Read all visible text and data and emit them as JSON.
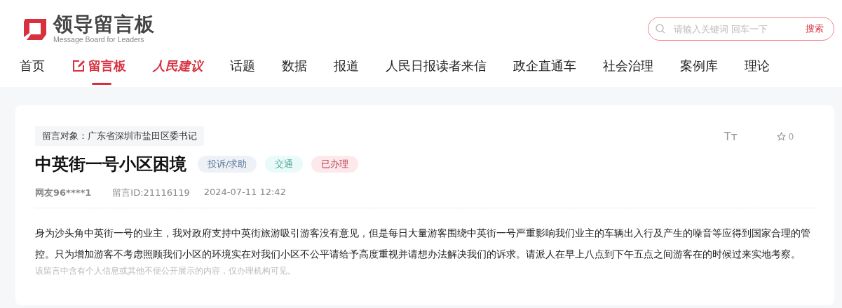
{
  "logo": {
    "title": "领导留言板",
    "subtitle": "Message Board for Leaders"
  },
  "search": {
    "placeholder": "请输入关键词 回车一下",
    "button": "搜索"
  },
  "nav": [
    {
      "label": "首页",
      "kind": "text",
      "selected": false
    },
    {
      "label": "留言板",
      "kind": "icon",
      "selected": true
    },
    {
      "label": "人民建议",
      "kind": "brand",
      "selected": false
    },
    {
      "label": "话题",
      "kind": "text",
      "selected": false
    },
    {
      "label": "数据",
      "kind": "text",
      "selected": false
    },
    {
      "label": "报道",
      "kind": "text",
      "selected": false
    },
    {
      "label": "人民日报读者来信",
      "kind": "text",
      "selected": false
    },
    {
      "label": "政企直通车",
      "kind": "text",
      "selected": false
    },
    {
      "label": "社会治理",
      "kind": "text",
      "selected": false
    },
    {
      "label": "案例库",
      "kind": "text",
      "selected": false
    },
    {
      "label": "理论",
      "kind": "text",
      "selected": false
    }
  ],
  "message": {
    "target": "留言对象：广东省深圳市盐田区委书记",
    "title": "中英街一号小区困境",
    "tags": [
      {
        "label": "投诉/求助",
        "color": "#eef2f7"
      },
      {
        "label": "交通",
        "color": "#eafaf8"
      },
      {
        "label": "已办理",
        "color": "#fde9ec"
      }
    ],
    "font_toggle": "Tт",
    "favorites": "0",
    "author": "网友96****1",
    "id": "留言ID:21116119",
    "time": "2024-07-11 12:42",
    "body": "身为沙头角中英街一号的业主，我对政府支持中英街旅游吸引游客没有意见，但是每日大量游客围绕中英街一号严重影响我们业主的车辆出入行及产生的噪音等应得到国家合理的管控。只为增加游客不考虑照顾我们小区的环境实在对我们小区不公平请给予高度重视并请想办法解决我们的诉求。请派人在早上八点到下午五点之间游客在的时候过来实地考察。",
    "notice": "该留言中含有个人信息或其他不便公开展示的内容，仅办理机构可见。"
  }
}
